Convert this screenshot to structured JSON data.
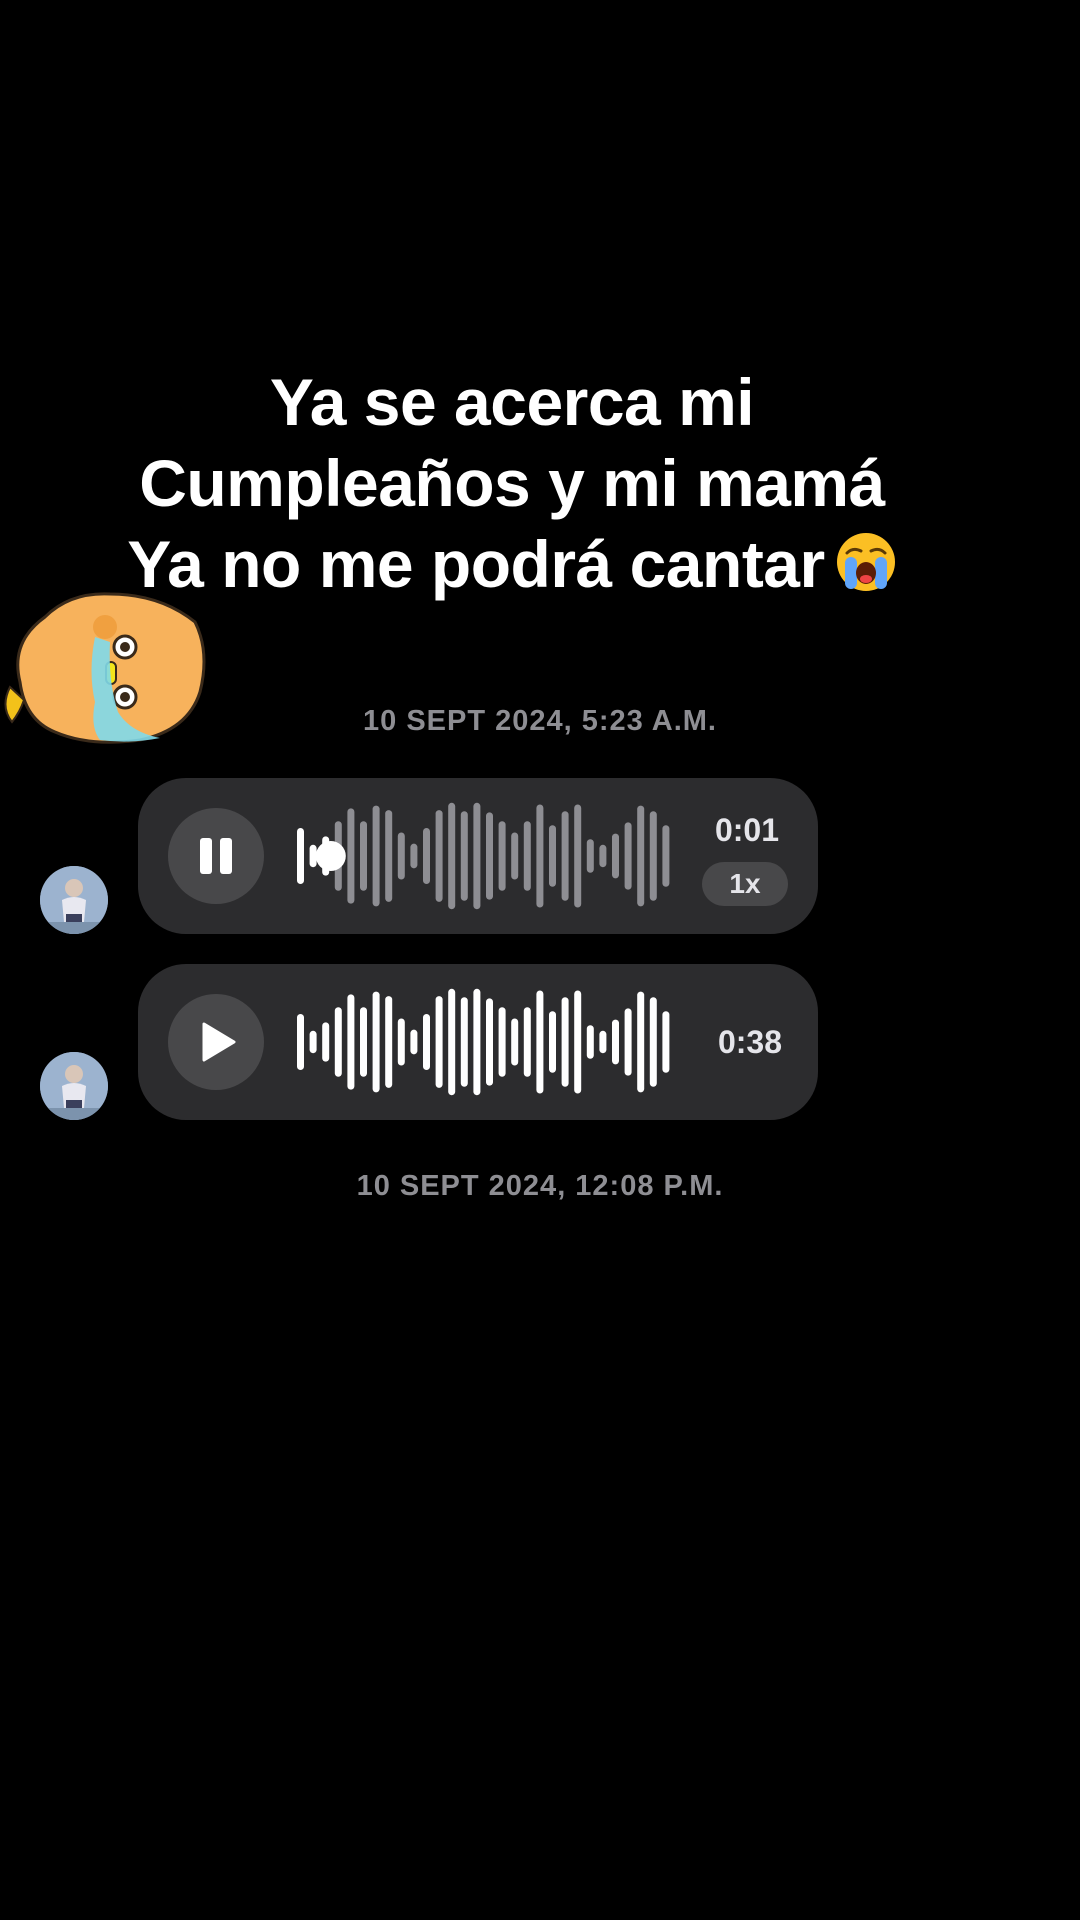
{
  "caption": {
    "line1": "Ya se acerca mi",
    "line2": "Cumpleaños y mi mamá",
    "line3": "Ya no me podrá cantar"
  },
  "conversation": {
    "timestamp_1": "10 SEPT 2024, 5:23 A.M.",
    "timestamp_2": "10 SEPT 2024, 12:08 P.M.",
    "voice_messages": [
      {
        "state": "playing",
        "control_icon": "pause-icon",
        "time": "0:01",
        "playback_speed": "1x",
        "progress": 0.1
      },
      {
        "state": "paused",
        "control_icon": "play-icon",
        "time": "0:38"
      }
    ]
  },
  "colors": {
    "background": "#000000",
    "bubble": "#2c2c2e",
    "button": "#48484a",
    "timestamp_text": "#8e8e93",
    "wave_played": "#ffffff",
    "wave_unplayed": "#8e8e93"
  }
}
